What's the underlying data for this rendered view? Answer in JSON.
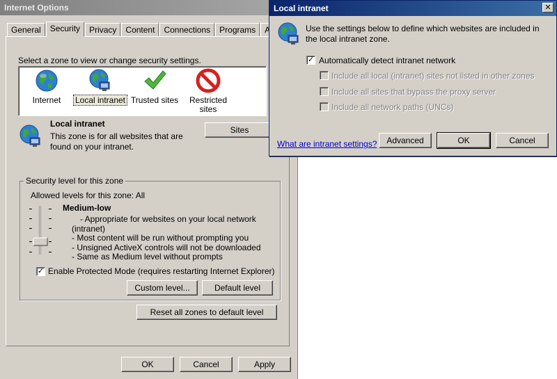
{
  "internet_options": {
    "title": "Internet Options",
    "tabs": [
      "General",
      "Security",
      "Privacy",
      "Content",
      "Connections",
      "Programs",
      "Advanced"
    ],
    "tab_advanced_visible": "Advan",
    "zone_prompt": "Select a zone to view or change security settings.",
    "zones": [
      {
        "label": "Internet",
        "icon": "globe-icon"
      },
      {
        "label": "Local intranet",
        "icon": "intranet-globe-icon"
      },
      {
        "label": "Trusted sites",
        "icon": "checkmark-icon"
      },
      {
        "label": "Restricted sites",
        "icon": "prohibited-icon"
      }
    ],
    "selected_zone": {
      "name": "Local intranet",
      "description": "This zone is for all websites that are found on your intranet."
    },
    "sites_button": "Sites",
    "security_group_title": "Security level for this zone",
    "allowed_levels": "Allowed levels for this zone: All",
    "level": {
      "name": "Medium-low",
      "bullets": [
        "- Appropriate for websites on your local network",
        "(intranet)",
        "- Most content will be run without prompting you",
        "- Unsigned ActiveX controls will not be downloaded",
        "- Same as Medium level without prompts"
      ]
    },
    "protected_mode_label": "Enable Protected Mode (requires restarting Internet Explorer)",
    "protected_mode_checked": true,
    "custom_level_button": "Custom level...",
    "default_level_button": "Default level",
    "reset_all_button": "Reset all zones to default level",
    "ok_button": "OK",
    "cancel_button": "Cancel",
    "apply_button": "Apply"
  },
  "local_intranet_dialog": {
    "title": "Local intranet",
    "close_glyph": "✕",
    "description_line1": "Use the settings below to define which websites are included in",
    "description_line2": "the local intranet zone.",
    "auto_detect_label": "Automatically detect intranet network",
    "auto_detect_checked": true,
    "options": [
      "Include all local (intranet) sites not listed in other zones",
      "Include all sites that bypass the proxy server",
      "Include all network paths (UNCs)"
    ],
    "help_link": "What are intranet settings?",
    "advanced_button": "Advanced",
    "ok_button": "OK",
    "cancel_button": "Cancel"
  }
}
